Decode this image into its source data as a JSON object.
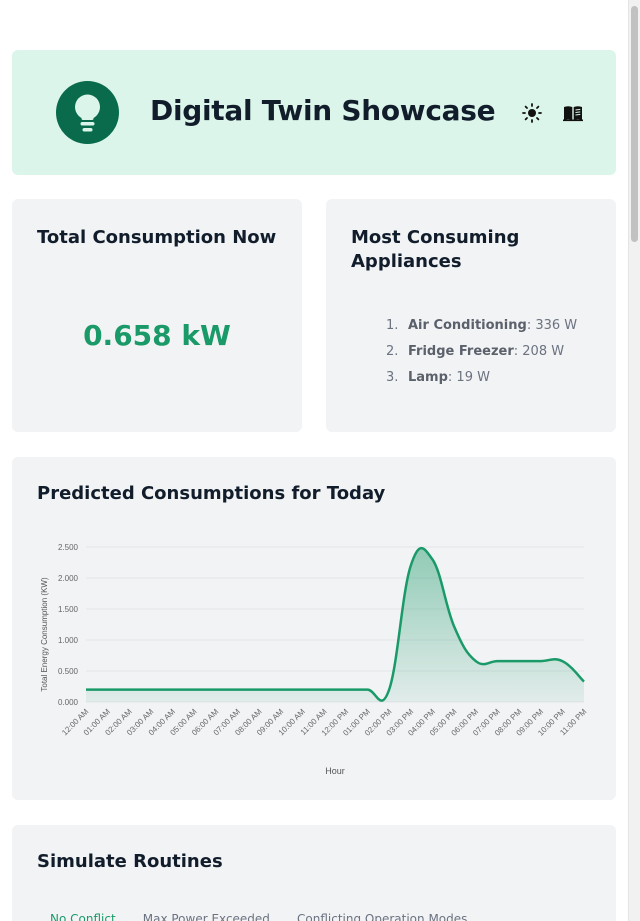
{
  "header": {
    "title": "Digital Twin Showcase",
    "logo_icon": "lightbulb-icon",
    "theme_icon": "sun-icon",
    "docs_icon": "book-icon"
  },
  "total_consumption": {
    "title": "Total Consumption Now",
    "value": "0.658 kW"
  },
  "top_appliances": {
    "title_line1": "Most Consuming",
    "title_line2": "Appliances",
    "items": [
      {
        "rank": "1.",
        "name": "Air Conditioning",
        "value": ": 336 W"
      },
      {
        "rank": "2.",
        "name": "Fridge Freezer",
        "value": ": 208 W"
      },
      {
        "rank": "3.",
        "name": "Lamp",
        "value": ": 19 W"
      }
    ]
  },
  "prediction": {
    "title": "Predicted Consumptions for Today"
  },
  "chart_data": {
    "type": "area",
    "ylabel": "Total Energy Consumption (KW)",
    "xlabel": "Hour",
    "ylim": [
      0,
      2.5
    ],
    "yticks": [
      "0.000",
      "0.500",
      "1.000",
      "1.500",
      "2.000",
      "2.500"
    ],
    "x": [
      "12:00 AM",
      "01:00 AM",
      "02:00 AM",
      "03:00 AM",
      "04:00 AM",
      "05:00 AM",
      "06:00 AM",
      "07:00 AM",
      "08:00 AM",
      "09:00 AM",
      "10:00 AM",
      "11:00 AM",
      "12:00 PM",
      "01:00 PM",
      "02:00 PM",
      "03:00 PM",
      "04:00 PM",
      "05:00 PM",
      "06:00 PM",
      "07:00 PM",
      "08:00 PM",
      "09:00 PM",
      "10:00 PM",
      "11:00 PM"
    ],
    "values": [
      0.2,
      0.2,
      0.2,
      0.2,
      0.2,
      0.2,
      0.2,
      0.2,
      0.2,
      0.2,
      0.2,
      0.2,
      0.2,
      0.2,
      0.2,
      2.2,
      2.3,
      1.22,
      0.66,
      0.66,
      0.66,
      0.66,
      0.66,
      0.33
    ],
    "grid": true,
    "color": "#1a9a69"
  },
  "simulate": {
    "title": "Simulate Routines",
    "tabs": [
      {
        "label": "No Conflict",
        "active": true
      },
      {
        "label": "Max Power Exceeded",
        "active": false
      },
      {
        "label": "Conflicting Operation Modes",
        "active": false
      }
    ]
  }
}
